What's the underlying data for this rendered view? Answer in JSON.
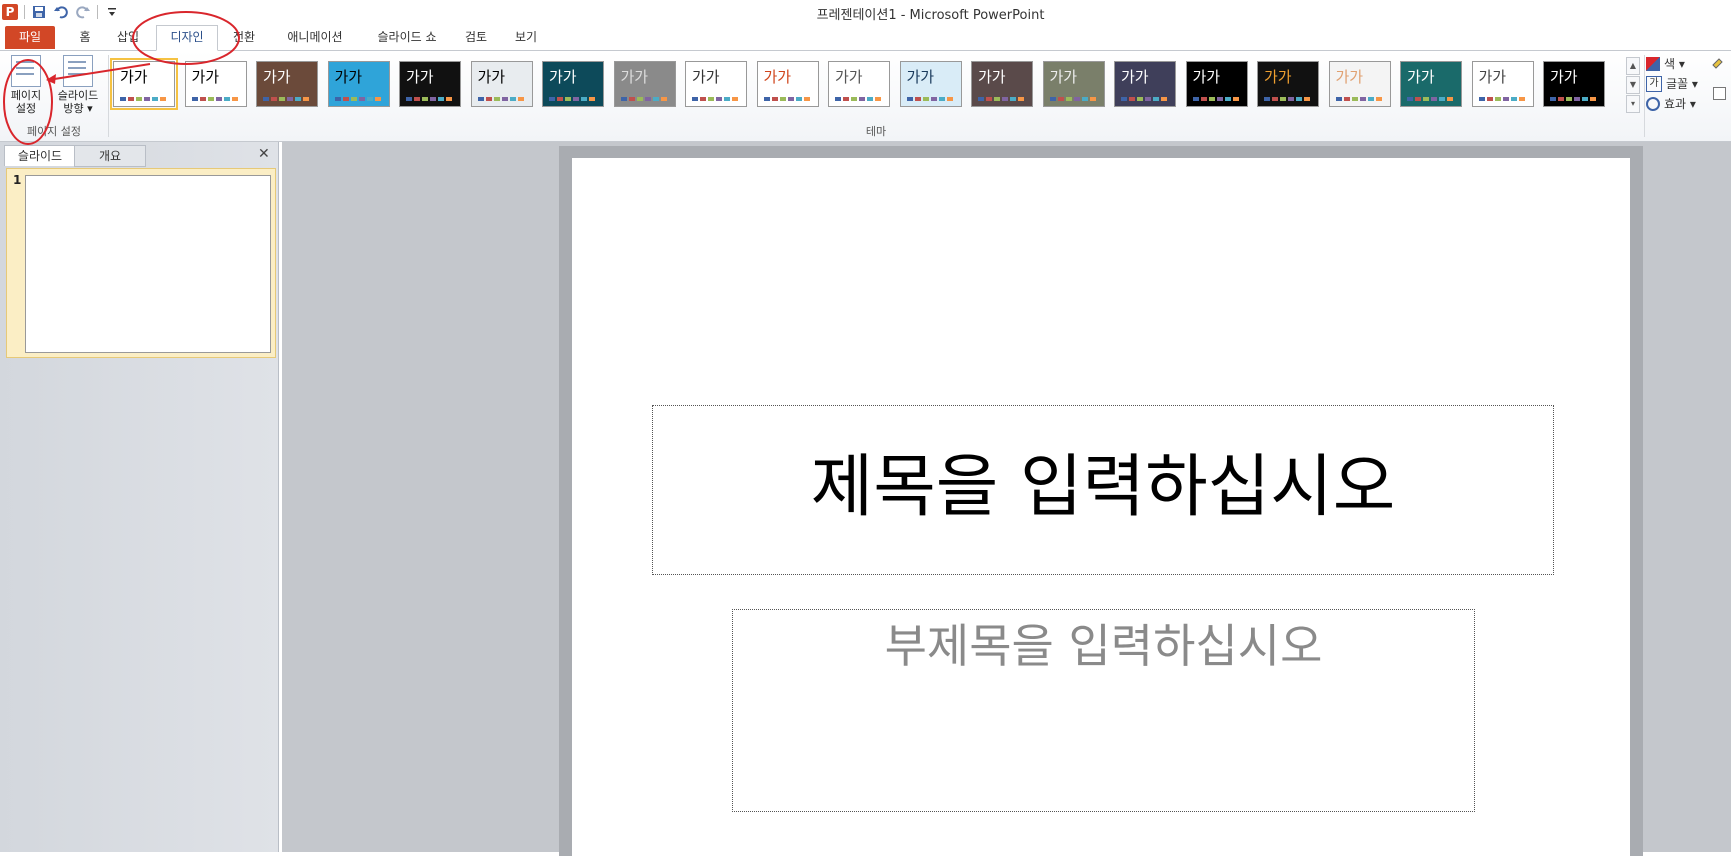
{
  "window": {
    "title": "프레젠테이션1 - Microsoft PowerPoint",
    "app_icon_letter": "P"
  },
  "quick_access": [
    "save-icon",
    "undo-icon",
    "redo-icon",
    "customize-icon"
  ],
  "tabs": [
    "파일",
    "홈",
    "삽입",
    "디자인",
    "전환",
    "애니메이션",
    "슬라이드 쇼",
    "검토",
    "보기"
  ],
  "active_tab": "디자인",
  "ribbon": {
    "page_setup": {
      "btn1": "페이지\n설정",
      "btn1_line1": "페이지",
      "btn1_line2": "설정",
      "btn2_line1": "슬라이드",
      "btn2_line2": "방향 ▾",
      "group": "페이지 설정"
    },
    "themes": {
      "group": "테마",
      "sample_text": "가가"
    },
    "options": {
      "colors": "색 ▾",
      "fonts": "글꼴 ▾",
      "effects": "효과 ▾"
    }
  },
  "panel": {
    "tab_slides": "슬라이드",
    "tab_outline": "개요",
    "close": "✕",
    "slide_number": "1"
  },
  "slide": {
    "title_placeholder": "제목을 입력하십시오",
    "subtitle_placeholder": "부제목을 입력하십시오"
  },
  "colors": {
    "file_tab": "#d24726",
    "accent": "#2b4f8a",
    "annotation": "#d9262c"
  }
}
